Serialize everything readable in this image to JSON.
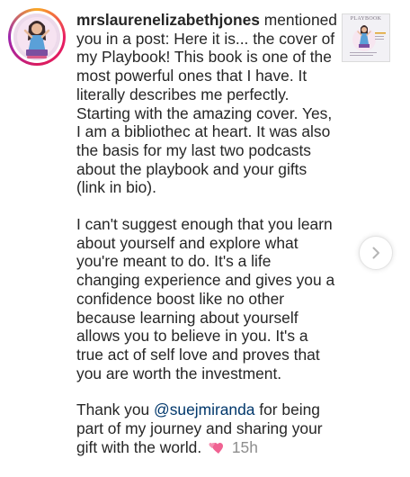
{
  "notification": {
    "username": "mrslaurenelizabethjones",
    "action_text": " mentioned you in a post: Here it is... the cover of my Playbook! This book is one of the most powerful ones that I have. It literally describes me perfectly. Starting with the amazing cover. Yes, I am a bibliothec at heart. It was also the basis for my last two podcasts about the playbook and your gifts (link in bio).",
    "paragraph2": "I can't suggest enough that you learn about yourself and explore what you're meant to do. It's a life changing experience and gives you a confidence boost like no other because learning about yourself allows you to believe in you. It's a true act of self love and proves that you are worth the investment.",
    "paragraph3_prefix": "Thank you ",
    "mention": "@suejmiranda",
    "paragraph3_suffix": " for being part of my journey and sharing your gift with the world.",
    "timestamp": "15h"
  },
  "thumbnail": {
    "title": "PLAYBOOK"
  },
  "icons": {
    "avatar_ring": "story-ring",
    "heart": "two-hearts-emoji",
    "next": "chevron-right-icon"
  },
  "colors": {
    "text": "#262626",
    "mention": "#00376b",
    "timestamp": "#8e8e8e",
    "heart": "#f06292"
  }
}
